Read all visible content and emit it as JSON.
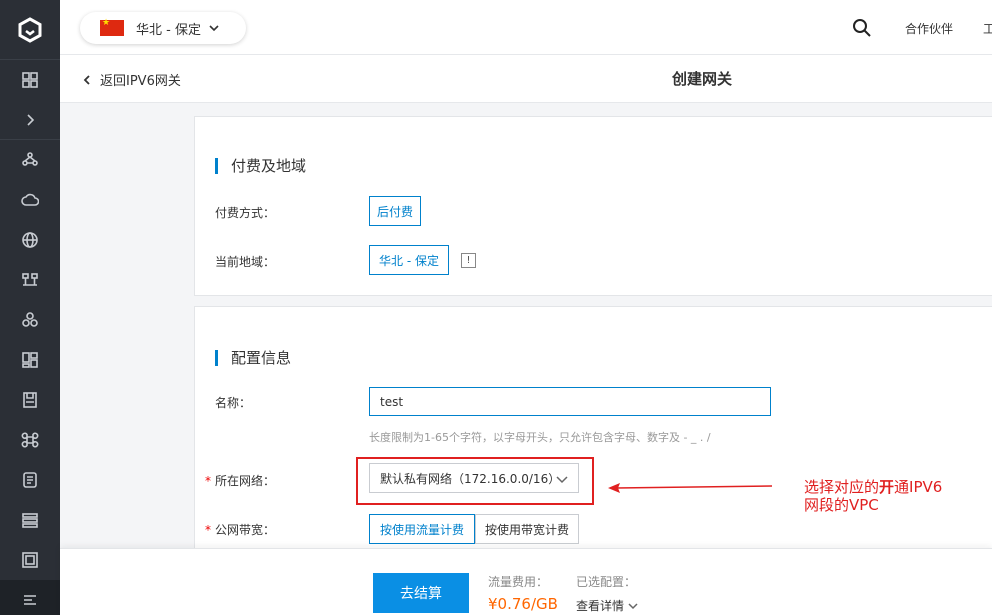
{
  "sidebar": {
    "items": [
      "logo-icon",
      "grid-icon",
      "chevron-right-icon",
      "nodes-icon",
      "cloud-icon",
      "globe-icon",
      "network-icon",
      "cluster-icon",
      "dashboard-icon",
      "storage-icon",
      "command-icon",
      "document-icon",
      "list-icon",
      "frame-icon",
      "menu-icon"
    ]
  },
  "topbar": {
    "region": "华北 - 保定",
    "partner": "合作伙伴",
    "cut_off": "工"
  },
  "header": {
    "back_label": "返回IPV6网关",
    "title": "创建网关"
  },
  "billing_section": {
    "title": "付费及地域",
    "pay_label": "付费方式：",
    "pay_value": "后付费",
    "region_label": "当前地域：",
    "region_value": "华北 - 保定",
    "info_glyph": "!"
  },
  "config_section": {
    "title": "配置信息",
    "name_label": "名称：",
    "name_value": "test",
    "name_hint": "长度限制为1-65个字符，以字母开头，只允许包含字母、数字及 - _ . /",
    "network_required": "*",
    "network_label": "所在网络：",
    "network_value": "默认私有网络（172.16.0.0/16）",
    "bandwidth_required": "*",
    "bandwidth_label": "公网带宽：",
    "bandwidth_options": [
      "按使用流量计费",
      "按使用带宽计费"
    ]
  },
  "annotation": {
    "line1_pre": "选择对应的",
    "line1_bold": "开",
    "line1_post": "通IPV6",
    "line2": "网段的VPC",
    "color": "#e02020"
  },
  "footer": {
    "checkout_label": "去结算",
    "fee_label": "流量费用：",
    "fee_value": "¥0.76/GB",
    "config_label": "已选配置：",
    "config_link": "查看详情"
  },
  "colors": {
    "accent": "#0081cc",
    "checkout": "#0a8fe4",
    "price": "#ff6600",
    "sidebar": "#2b2f36"
  }
}
